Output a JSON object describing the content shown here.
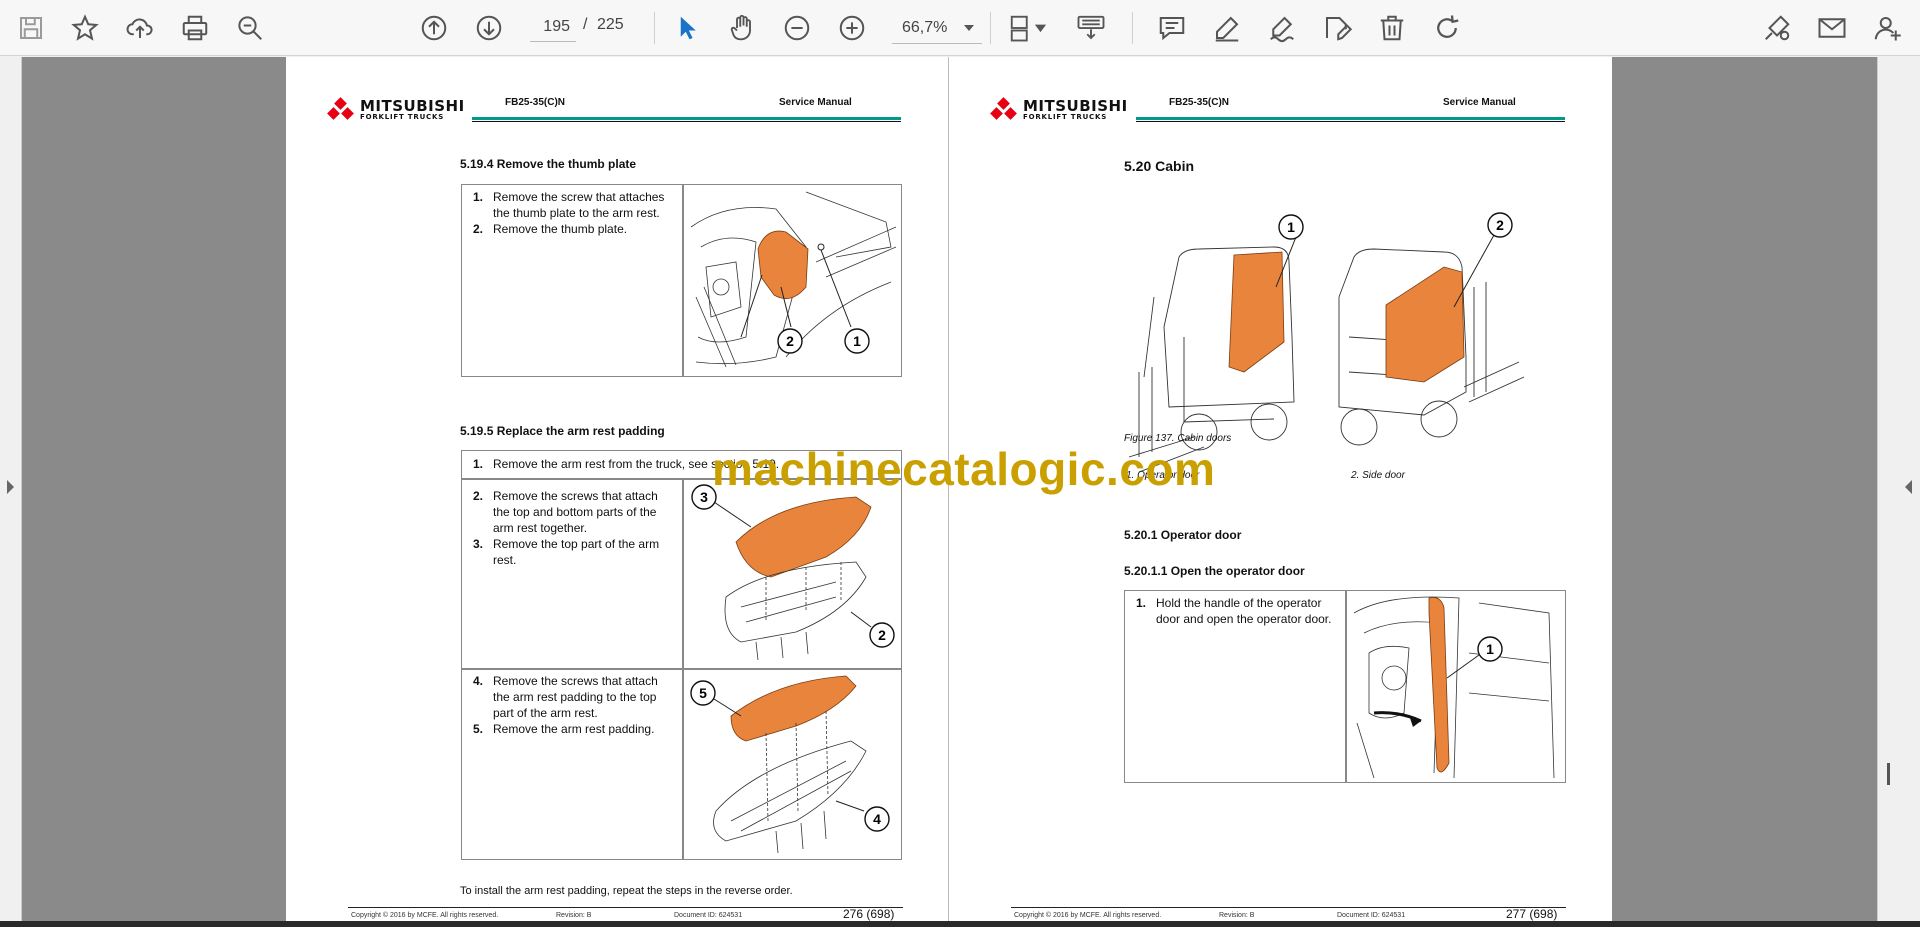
{
  "toolbar": {
    "current_page": "195",
    "slash": "/",
    "total_pages": "225",
    "zoom": "66,7%",
    "icons": [
      "save-icon",
      "star-icon",
      "upload-icon",
      "print-icon",
      "zoom-out-icon",
      "prev-page-icon",
      "next-page-icon",
      "select-cursor-icon",
      "hand-icon",
      "minus-icon",
      "plus-icon",
      "page-layout-icon",
      "keyboard-icon",
      "comment-icon",
      "pen-icon",
      "sign-icon",
      "stamp-icon",
      "trash-icon",
      "redo-icon",
      "tools-icon",
      "mail-icon",
      "user-icon"
    ],
    "accent": "#1a73c9"
  },
  "left_page": {
    "model": "FB25-35(C)N",
    "manual": "Service Manual",
    "brand_top": "MITSUBISHI",
    "brand_bottom": "FORKLIFT TRUCKS",
    "s1_title": "5.19.4    Remove the thumb plate",
    "s1_steps": [
      {
        "n": "1.",
        "text": "Remove the screw that attaches the thumb plate to the arm rest."
      },
      {
        "n": "2.",
        "text": "Remove the thumb plate."
      }
    ],
    "s2_title": "5.19.5    Replace the arm rest padding",
    "s2_row1": {
      "n": "1.",
      "text": "Remove the arm rest from the truck, see section 5.19."
    },
    "s2_row2": [
      {
        "n": "2.",
        "text": "Remove the screws that attach the top and bottom parts of the arm rest together."
      },
      {
        "n": "3.",
        "text": "Remove the top part of the arm rest."
      }
    ],
    "s2_row3": [
      {
        "n": "4.",
        "text": "Remove the screws that attach the arm rest padding to the top part of the arm rest."
      },
      {
        "n": "5.",
        "text": "Remove the arm rest padding."
      }
    ],
    "closing": "To install the arm rest padding, repeat the steps in the reverse order.",
    "callouts": [
      "1",
      "2",
      "3",
      "4",
      "5"
    ],
    "footer_copy": "Copyright © 2016 by MCFE. All rights reserved.",
    "footer_rev": "Revision: B",
    "footer_doc": "Document ID: 624531",
    "footer_page": "276 (698)"
  },
  "right_page": {
    "model": "FB25-35(C)N",
    "manual": "Service Manual",
    "brand_top": "MITSUBISHI",
    "brand_bottom": "FORKLIFT TRUCKS",
    "title": "5.20    Cabin",
    "figure_caption": "Figure 137. Cabin doors",
    "legend1": "1.     Operator door",
    "legend2": "2.     Side door",
    "s1_title": "5.20.1    Operator door",
    "s2_title": "5.20.1.1 Open the operator door",
    "step1": {
      "n": "1.",
      "text": "Hold the handle of the operator door and open the operator door."
    },
    "callouts": [
      "1",
      "2"
    ],
    "footer_copy": "Copyright © 2016 by MCFE. All rights reserved.",
    "footer_rev": "Revision: B",
    "footer_doc": "Document ID: 624531",
    "footer_page": "277 (698)"
  },
  "watermark": "machinecatalogic.com",
  "colors": {
    "orange": "#e8843c",
    "teal": "#009a8a",
    "red": "#e60012",
    "watermark": "#c9a000"
  }
}
